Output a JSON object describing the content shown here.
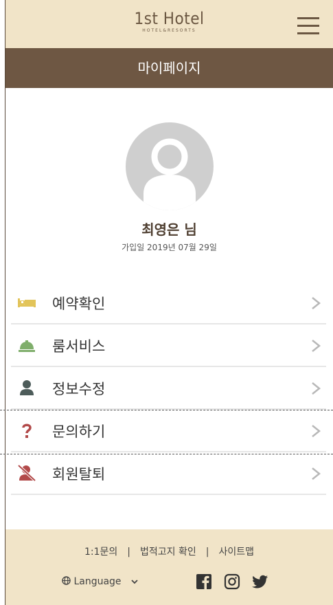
{
  "header": {
    "logo_main": "1st Hotel",
    "logo_sub": "HOTEL&RESORTS",
    "menu_icon": "hamburger-icon"
  },
  "page_title": "마이페이지",
  "profile": {
    "avatar_icon": "user-avatar-icon",
    "name": "최영은 님",
    "joined": "가입일 2019년 07월 29일"
  },
  "menu": {
    "items": [
      {
        "label": "예약확인",
        "icon": "bed-icon",
        "color": "#e2c45a"
      },
      {
        "label": "룸서비스",
        "icon": "service-bell-icon",
        "color": "#7fae6b"
      },
      {
        "label": "정보수정",
        "icon": "user-icon",
        "color": "#4d5c5a"
      },
      {
        "label": "문의하기",
        "icon": "question-icon",
        "color": "#b24a4a"
      },
      {
        "label": "회원탈퇴",
        "icon": "user-slash-icon",
        "color": "#b24a4a"
      }
    ]
  },
  "footer": {
    "links": [
      "1:1문의",
      "법적고지 확인",
      "사이트맵"
    ],
    "separator": "|",
    "language": "Language",
    "social": [
      "facebook-icon",
      "instagram-icon",
      "twitter-icon"
    ]
  },
  "colors": {
    "header_bg": "#f1e4c8",
    "title_bg": "#6e5743",
    "footer_bg": "#f1e4c8"
  }
}
